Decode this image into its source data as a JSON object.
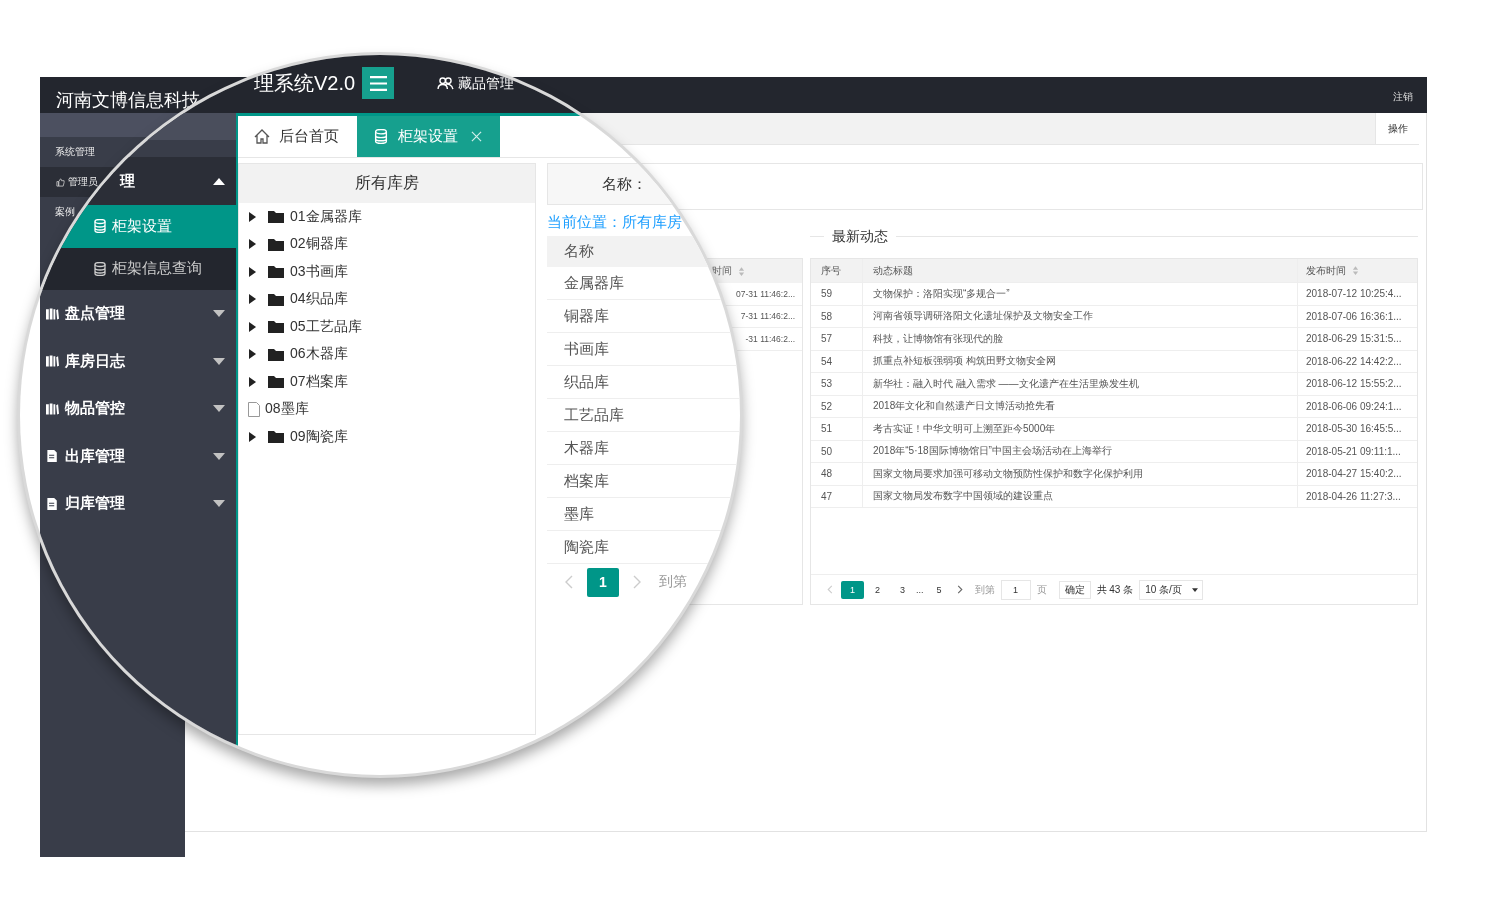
{
  "screen": {
    "header": {
      "title": "河南文博信息科技",
      "logout": "注销"
    },
    "sidebar": {
      "items": [
        {
          "label": "系统管理",
          "kind": "heading"
        },
        {
          "label": "管理员",
          "kind": "item"
        },
        {
          "label": "案例",
          "kind": "heading"
        }
      ]
    },
    "toolbar": {
      "action": "操作"
    },
    "left_table": {
      "column": "时间",
      "rows": [
        "07-31 11:46:2...",
        "7-31 11:46:2...",
        "-31 11:46:2..."
      ]
    },
    "news": {
      "title": "最新动态",
      "columns": [
        "序号",
        "动态标题",
        "发布时间"
      ],
      "rows": [
        {
          "id": "59",
          "title": "文物保护：洛阳实现“多规合一”",
          "time": "2018-07-12 10:25:4..."
        },
        {
          "id": "58",
          "title": "河南省领导调研洛阳文化遗址保护及文物安全工作",
          "time": "2018-07-06 16:36:1..."
        },
        {
          "id": "57",
          "title": "科技，让博物馆有张现代的脸",
          "time": "2018-06-29 15:31:5..."
        },
        {
          "id": "54",
          "title": "抓重点补短板强弱项 构筑田野文物安全网",
          "time": "2018-06-22 14:42:2..."
        },
        {
          "id": "53",
          "title": "新华社：融入时代 融入需求 ——文化遗产在生活里焕发生机",
          "time": "2018-06-12 15:55:2..."
        },
        {
          "id": "52",
          "title": "2018年文化和自然遗产日文博活动抢先看",
          "time": "2018-06-06 09:24:1..."
        },
        {
          "id": "51",
          "title": "考古实证！中华文明可上溯至距今5000年",
          "time": "2018-05-30 16:45:5..."
        },
        {
          "id": "50",
          "title": "2018年“5·18国际博物馆日”中国主会场活动在上海举行",
          "time": "2018-05-21 09:11:1..."
        },
        {
          "id": "48",
          "title": "国家文物局要求加强可移动文物预防性保护和数字化保护利用",
          "time": "2018-04-27 15:40:2..."
        },
        {
          "id": "47",
          "title": "国家文物局发布数字中国领域的建设重点",
          "time": "2018-04-26 11:27:3..."
        }
      ],
      "pagination": {
        "pages": [
          {
            "label": "1",
            "kind": "page",
            "selected": true
          },
          {
            "label": "2",
            "kind": "page",
            "selected": false
          },
          {
            "label": "3",
            "kind": "page",
            "selected": false
          },
          {
            "label": "...",
            "kind": "ellipsis",
            "selected": false
          },
          {
            "label": "5",
            "kind": "page",
            "selected": false
          }
        ],
        "goto_label": "到第",
        "goto_value": "1",
        "page_unit": "页",
        "confirm": "确定",
        "total": "共 43 条",
        "page_size": "10 条/页"
      }
    }
  },
  "magnifier": {
    "header": {
      "title": "理系统V2.0",
      "nav_item": "藏品管理"
    },
    "sidebar": {
      "items": [
        {
          "label": "理",
          "expanded": true,
          "children": [
            {
              "label": "柜架设置",
              "selected": true
            },
            {
              "label": "柜架信息查询",
              "selected": false
            }
          ]
        },
        {
          "label": "盘点管理",
          "expanded": false
        },
        {
          "label": "库房日志",
          "expanded": false
        },
        {
          "label": "物品管控",
          "expanded": false
        },
        {
          "label": "出库管理",
          "expanded": false
        },
        {
          "label": "归库管理",
          "expanded": false
        }
      ]
    },
    "tabs": [
      {
        "label": "后台首页",
        "selected": false,
        "closable": false
      },
      {
        "label": "柜架设置",
        "selected": true,
        "closable": true
      }
    ],
    "tree": {
      "title": "所有库房",
      "items": [
        {
          "label": "01金属器库",
          "kind": "folder"
        },
        {
          "label": "02铜器库",
          "kind": "folder"
        },
        {
          "label": "03书画库",
          "kind": "folder"
        },
        {
          "label": "04织品库",
          "kind": "folder"
        },
        {
          "label": "05工艺品库",
          "kind": "folder"
        },
        {
          "label": "06木器库",
          "kind": "folder"
        },
        {
          "label": "07档案库",
          "kind": "folder"
        },
        {
          "label": "08墨库",
          "kind": "file"
        },
        {
          "label": "09陶瓷库",
          "kind": "folder"
        }
      ]
    },
    "search": {
      "label": "名称："
    },
    "breadcrumb": "当前位置：所有库房",
    "table": {
      "column": "名称",
      "rows": [
        "金属器库",
        "铜器库",
        "书画库",
        "织品库",
        "工艺品库",
        "木器库",
        "档案库",
        "墨库",
        "陶瓷库"
      ]
    },
    "pagination": {
      "pages": [
        {
          "label": "1",
          "selected": true
        }
      ],
      "goto_label": "到第"
    }
  }
}
